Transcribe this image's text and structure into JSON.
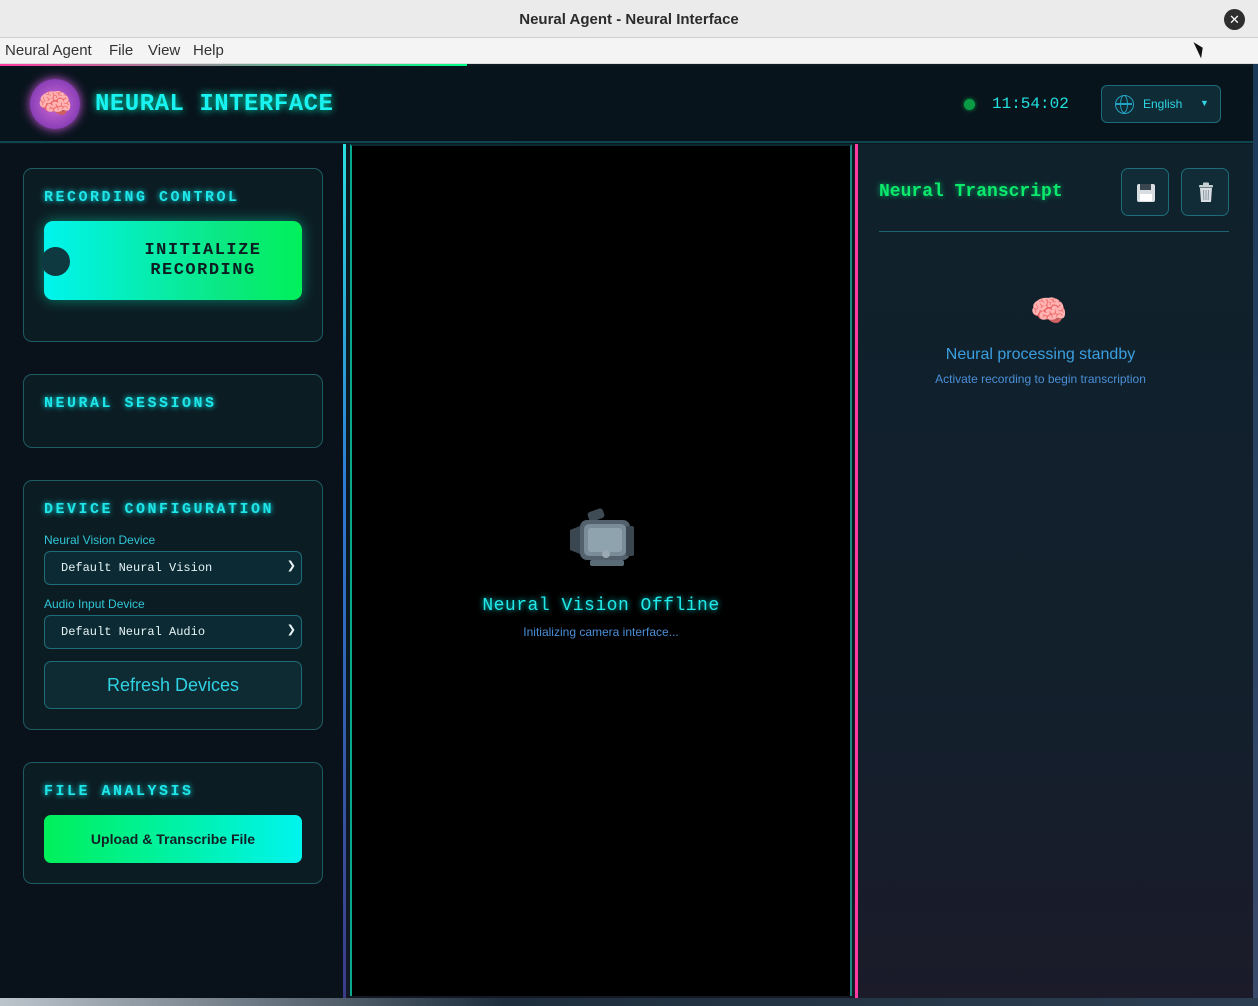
{
  "window": {
    "title": "Neural Agent - Neural Interface",
    "close_glyph": "✕"
  },
  "menubar": {
    "items": [
      "Neural Agent",
      "File",
      "View",
      "Help"
    ]
  },
  "header": {
    "logo_glyph": "🧠",
    "title": "NEURAL INTERFACE",
    "clock": "11:54:02",
    "status_color": "#0a9c45",
    "language": {
      "selected": "English",
      "icon": "globe-icon"
    }
  },
  "sidebar": {
    "recording": {
      "heading": "RECORDING CONTROL",
      "button_line1": "INITIALIZE",
      "button_line2": "RECORDING"
    },
    "sessions": {
      "heading": "NEURAL SESSIONS"
    },
    "devices": {
      "heading": "DEVICE CONFIGURATION",
      "vision_label": "Neural Vision Device",
      "vision_value": "Default Neural Vision",
      "audio_label": "Audio Input Device",
      "audio_value": "Default Neural Audio",
      "refresh_label": "Refresh Devices"
    },
    "files": {
      "heading": "FILE ANALYSIS",
      "upload_label": "Upload & Transcribe File"
    }
  },
  "video": {
    "icon": "video-camera-icon",
    "status": "Neural Vision Offline",
    "substatus": "Initializing camera interface..."
  },
  "transcript": {
    "heading": "Neural Transcript",
    "save_glyph": "💾",
    "delete_glyph": "🗑️",
    "empty_glyph": "🧠",
    "empty_title": "Neural processing standby",
    "empty_sub": "Activate recording to begin transcription"
  },
  "colors": {
    "accent_cyan": "#19f2f0",
    "accent_green": "#0bea6a",
    "accent_pink": "#ff3aa0"
  }
}
